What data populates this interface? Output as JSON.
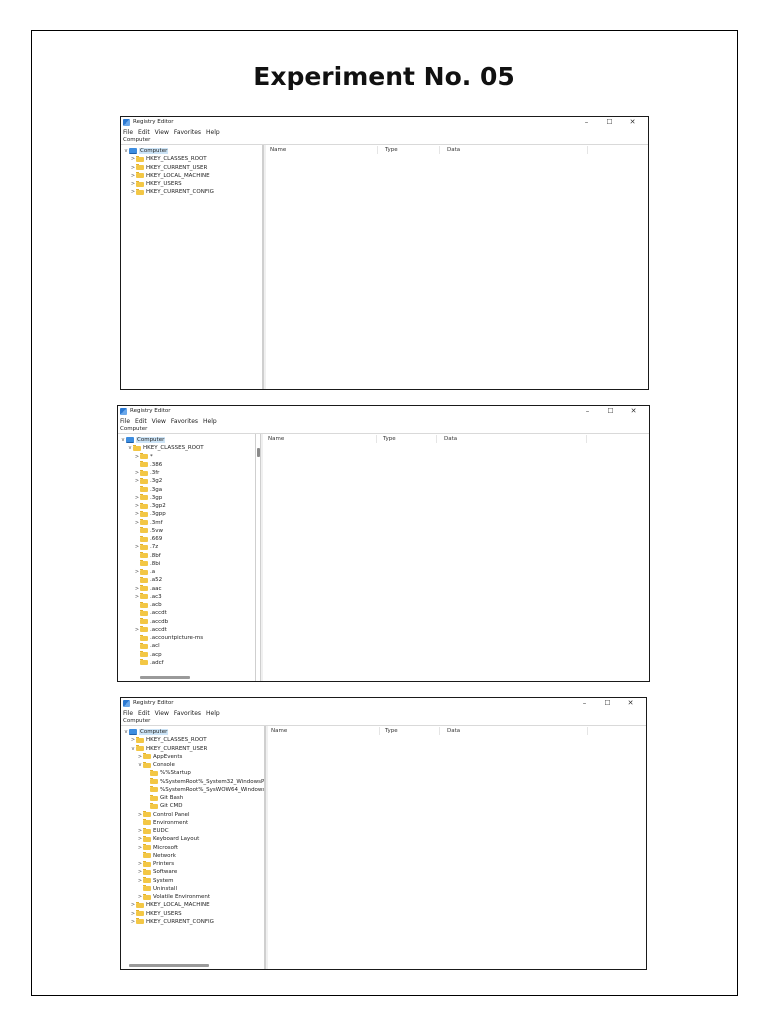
{
  "document": {
    "title": "Experiment No. 05"
  },
  "window": {
    "title": "Registry Editor",
    "menu": [
      "File",
      "Edit",
      "View",
      "Favorites",
      "Help"
    ],
    "address": "Computer",
    "columns": [
      "Name",
      "Type",
      "Data"
    ],
    "controls": {
      "minimize": "–",
      "maximize": "☐",
      "close": "✕"
    }
  },
  "screenshots": [
    {
      "tree": [
        {
          "label": "Computer",
          "level": 0,
          "expander": "v",
          "icon": "computer-icon",
          "selected": true
        },
        {
          "label": "HKEY_CLASSES_ROOT",
          "level": 1,
          "expander": ">",
          "icon": "folder-icon"
        },
        {
          "label": "HKEY_CURRENT_USER",
          "level": 1,
          "expander": ">",
          "icon": "folder-icon"
        },
        {
          "label": "HKEY_LOCAL_MACHINE",
          "level": 1,
          "expander": ">",
          "icon": "folder-icon"
        },
        {
          "label": "HKEY_USERS",
          "level": 1,
          "expander": ">",
          "icon": "folder-icon"
        },
        {
          "label": "HKEY_CURRENT_CONFIG",
          "level": 1,
          "expander": ">",
          "icon": "folder-icon"
        }
      ]
    },
    {
      "tree": [
        {
          "label": "Computer",
          "level": 0,
          "expander": "v",
          "icon": "computer-icon",
          "selected": true
        },
        {
          "label": "HKEY_CLASSES_ROOT",
          "level": 1,
          "expander": "v",
          "icon": "folder-icon"
        },
        {
          "label": "*",
          "level": 2,
          "expander": ">",
          "icon": "folder-icon"
        },
        {
          "label": ".386",
          "level": 2,
          "expander": "",
          "icon": "folder-icon"
        },
        {
          "label": ".3fr",
          "level": 2,
          "expander": ">",
          "icon": "folder-icon"
        },
        {
          "label": ".3g2",
          "level": 2,
          "expander": ">",
          "icon": "folder-icon"
        },
        {
          "label": ".3ga",
          "level": 2,
          "expander": "",
          "icon": "folder-icon"
        },
        {
          "label": ".3gp",
          "level": 2,
          "expander": ">",
          "icon": "folder-icon"
        },
        {
          "label": ".3gp2",
          "level": 2,
          "expander": ">",
          "icon": "folder-icon"
        },
        {
          "label": ".3gpp",
          "level": 2,
          "expander": ">",
          "icon": "folder-icon"
        },
        {
          "label": ".3mf",
          "level": 2,
          "expander": ">",
          "icon": "folder-icon"
        },
        {
          "label": ".5vw",
          "level": 2,
          "expander": "",
          "icon": "folder-icon"
        },
        {
          "label": ".669",
          "level": 2,
          "expander": "",
          "icon": "folder-icon"
        },
        {
          "label": ".7z",
          "level": 2,
          "expander": ">",
          "icon": "folder-icon"
        },
        {
          "label": ".8bf",
          "level": 2,
          "expander": "",
          "icon": "folder-icon"
        },
        {
          "label": ".8bi",
          "level": 2,
          "expander": "",
          "icon": "folder-icon"
        },
        {
          "label": ".a",
          "level": 2,
          "expander": ">",
          "icon": "folder-icon"
        },
        {
          "label": ".a52",
          "level": 2,
          "expander": "",
          "icon": "folder-icon"
        },
        {
          "label": ".aac",
          "level": 2,
          "expander": ">",
          "icon": "folder-icon"
        },
        {
          "label": ".ac3",
          "level": 2,
          "expander": ">",
          "icon": "folder-icon"
        },
        {
          "label": ".acb",
          "level": 2,
          "expander": "",
          "icon": "folder-icon"
        },
        {
          "label": ".accdt",
          "level": 2,
          "expander": "",
          "icon": "folder-icon"
        },
        {
          "label": ".accdb",
          "level": 2,
          "expander": "",
          "icon": "folder-icon"
        },
        {
          "label": ".accdt",
          "level": 2,
          "expander": ">",
          "icon": "folder-icon"
        },
        {
          "label": ".accountpicture-ms",
          "level": 2,
          "expander": "",
          "icon": "folder-icon"
        },
        {
          "label": ".acl",
          "level": 2,
          "expander": "",
          "icon": "folder-icon"
        },
        {
          "label": ".acp",
          "level": 2,
          "expander": "",
          "icon": "folder-icon"
        },
        {
          "label": ".adcf",
          "level": 2,
          "expander": "",
          "icon": "folder-icon"
        }
      ]
    },
    {
      "tree": [
        {
          "label": "Computer",
          "level": 0,
          "expander": "v",
          "icon": "computer-icon",
          "selected": true
        },
        {
          "label": "HKEY_CLASSES_ROOT",
          "level": 1,
          "expander": ">",
          "icon": "folder-icon"
        },
        {
          "label": "HKEY_CURRENT_USER",
          "level": 1,
          "expander": "v",
          "icon": "folder-icon"
        },
        {
          "label": "AppEvents",
          "level": 2,
          "expander": ">",
          "icon": "folder-icon"
        },
        {
          "label": "Console",
          "level": 2,
          "expander": "v",
          "icon": "folder-icon"
        },
        {
          "label": "%%Startup",
          "level": 3,
          "expander": "",
          "icon": "folder-icon"
        },
        {
          "label": "%SystemRoot%_System32_WindowsP",
          "level": 3,
          "expander": "",
          "icon": "folder-icon"
        },
        {
          "label": "%SystemRoot%_SysWOW64_Windows",
          "level": 3,
          "expander": "",
          "icon": "folder-icon"
        },
        {
          "label": "Git Bash",
          "level": 3,
          "expander": "",
          "icon": "folder-icon"
        },
        {
          "label": "Git CMD",
          "level": 3,
          "expander": "",
          "icon": "folder-icon"
        },
        {
          "label": "Control Panel",
          "level": 2,
          "expander": ">",
          "icon": "folder-icon"
        },
        {
          "label": "Environment",
          "level": 2,
          "expander": "",
          "icon": "folder-icon"
        },
        {
          "label": "EUDC",
          "level": 2,
          "expander": ">",
          "icon": "folder-icon"
        },
        {
          "label": "Keyboard Layout",
          "level": 2,
          "expander": ">",
          "icon": "folder-icon"
        },
        {
          "label": "Microsoft",
          "level": 2,
          "expander": ">",
          "icon": "folder-icon"
        },
        {
          "label": "Network",
          "level": 2,
          "expander": "",
          "icon": "folder-icon"
        },
        {
          "label": "Printers",
          "level": 2,
          "expander": ">",
          "icon": "folder-icon"
        },
        {
          "label": "Software",
          "level": 2,
          "expander": ">",
          "icon": "folder-icon"
        },
        {
          "label": "System",
          "level": 2,
          "expander": ">",
          "icon": "folder-icon"
        },
        {
          "label": "Uninstall",
          "level": 2,
          "expander": "",
          "icon": "folder-icon"
        },
        {
          "label": "Volatile Environment",
          "level": 2,
          "expander": ">",
          "icon": "folder-icon"
        },
        {
          "label": "HKEY_LOCAL_MACHINE",
          "level": 1,
          "expander": ">",
          "icon": "folder-icon"
        },
        {
          "label": "HKEY_USERS",
          "level": 1,
          "expander": ">",
          "icon": "folder-icon"
        },
        {
          "label": "HKEY_CURRENT_CONFIG",
          "level": 1,
          "expander": ">",
          "icon": "folder-icon"
        }
      ]
    }
  ]
}
